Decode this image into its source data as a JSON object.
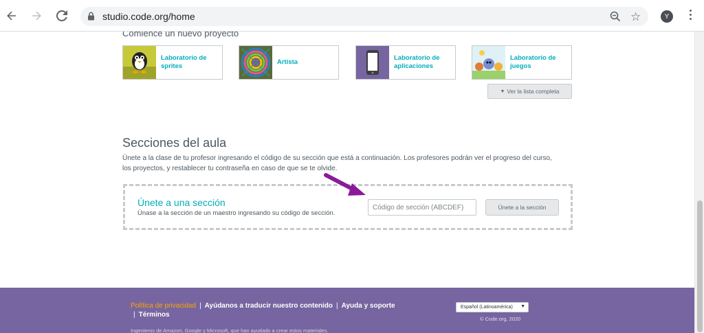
{
  "browser": {
    "url": "studio.code.org/home",
    "avatar_initial": "Y"
  },
  "projects": {
    "heading": "Comience un nuevo proyecto",
    "cards": [
      {
        "label": "Laboratorio de sprites",
        "icon": "sprite-lab-icon"
      },
      {
        "label": "Artista",
        "icon": "artist-icon"
      },
      {
        "label": "Laboratorio de aplicaciones",
        "icon": "app-lab-icon"
      },
      {
        "label": "Laboratorio de juegos",
        "icon": "game-lab-icon"
      }
    ],
    "full_list_label": "Ver la lista completa"
  },
  "sections": {
    "title": "Secciones del aula",
    "description": "Únete a la clase de tu profesor ingresando el código de su sección que está a continuación. Los profesores podrán ver el progreso del curso, los proyectos, y restablecer tu contraseña en caso de que se te olvide.",
    "join": {
      "title": "Únete a una sección",
      "subtitle": "Únase a la sección de un maestro ingresando su código de sección.",
      "input_placeholder": "Código de sección (ABCDEF)",
      "button_label": "Únete a la sección"
    }
  },
  "footer": {
    "privacy": "Política de privacidad",
    "translate": "Ayúdanos a traducir nuestro contenido",
    "help": "Ayuda y soporte",
    "terms": "Términos",
    "language": "Español (Latinoamérica)",
    "copyright": "© Code.org, 2020",
    "note": "Ingenieros de Amazon, Google y Microsoft, que han ayudado a crear estos materiales."
  },
  "colors": {
    "accent": "#00adbc",
    "footer_bg": "#7665a0",
    "privacy_link": "#ffa400",
    "arrow": "#8b1a9a"
  }
}
